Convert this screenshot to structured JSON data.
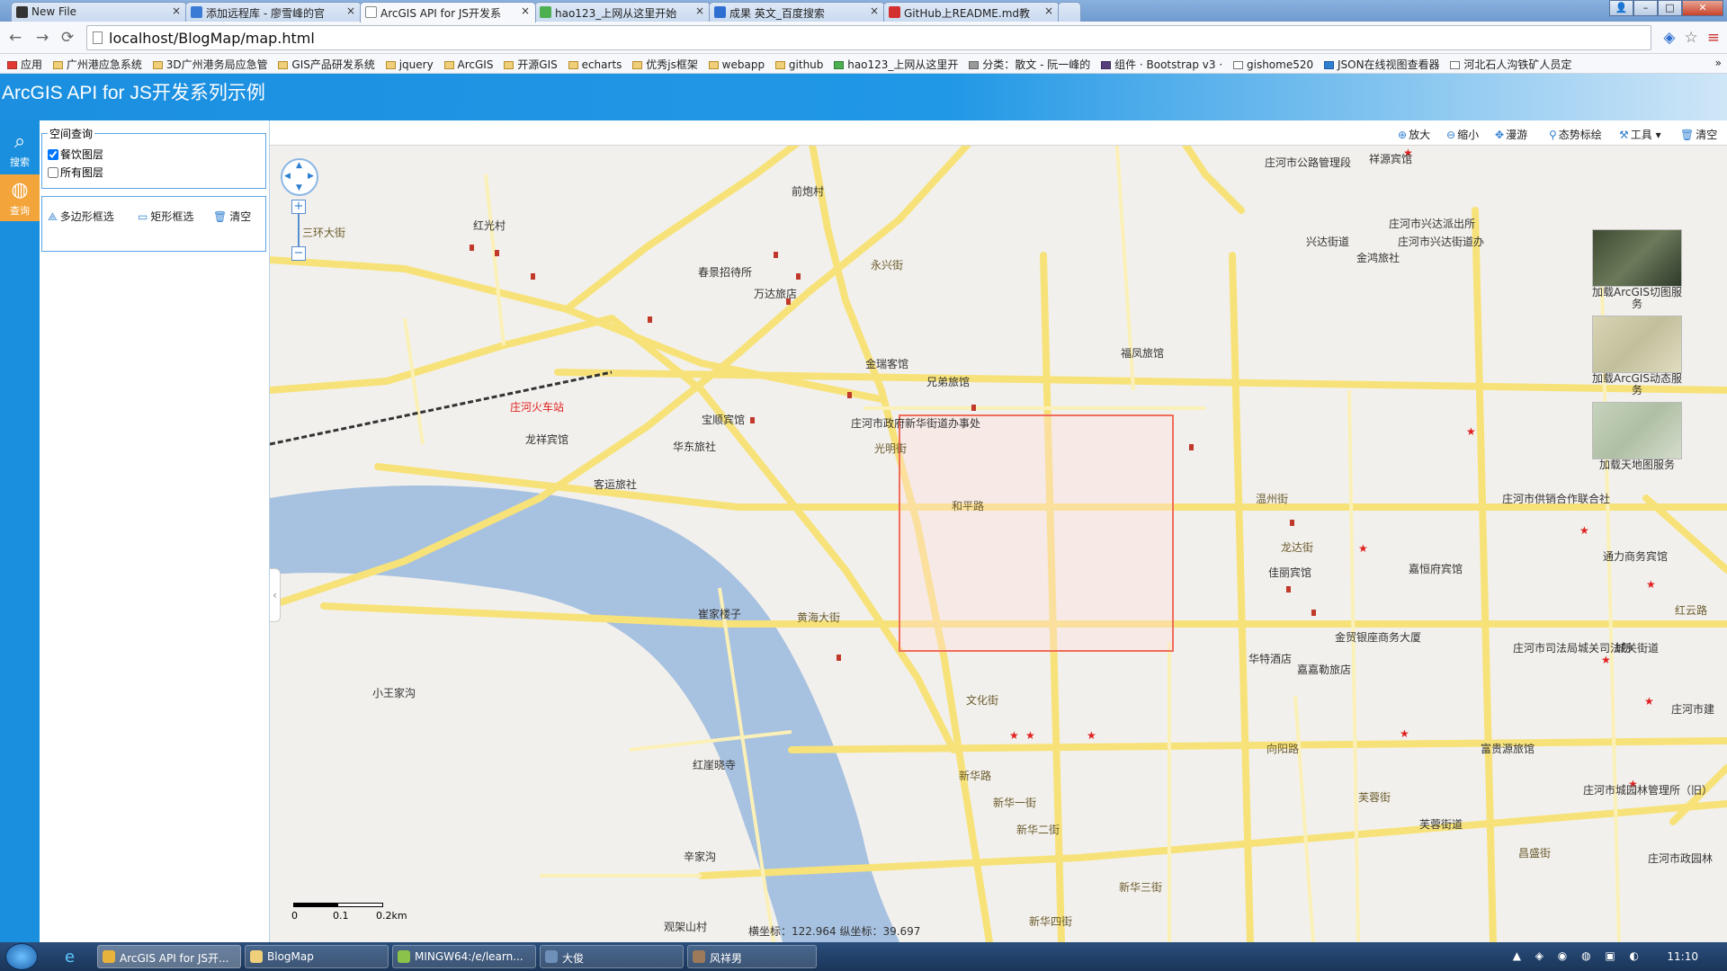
{
  "browser": {
    "tabs": [
      {
        "label": "New File",
        "icon_color": "#333333"
      },
      {
        "label": "添加远程库 - 廖雪峰的官",
        "icon_color": "#3a7bd5"
      },
      {
        "label": "ArcGIS API for JS开发系",
        "icon_color": "#777777",
        "active": true
      },
      {
        "label": "hao123_上网从这里开始",
        "icon_color": "#4caf50"
      },
      {
        "label": "成果 英文_百度搜索",
        "icon_color": "#2f6fd1"
      },
      {
        "label": "GitHub上README.md教",
        "icon_color": "#d32f2f"
      }
    ],
    "url": "localhost/BlogMap/map.html",
    "bookmarks": [
      "应用",
      "广州港应急系统",
      "3D广州港务局应急管",
      "GIS产品研发系统",
      "jquery",
      "ArcGIS",
      "开源GIS",
      "echarts",
      "优秀js框架",
      "webapp",
      "github",
      "hao123_上网从这里开",
      "分类：散文 - 阮一峰的",
      "组件 · Bootstrap v3 ·",
      "gishome520",
      "JSON在线视图查看器",
      "河北石人沟铁矿人员定"
    ]
  },
  "app": {
    "title": "ArcGIS API for JS开发系列示例",
    "nav": [
      {
        "label": "搜索",
        "icon": "search-icon"
      },
      {
        "label": "查询",
        "icon": "globe-icon"
      }
    ]
  },
  "panel": {
    "legend": "空间查询",
    "layers": [
      {
        "label": "餐饮图层",
        "checked": true
      },
      {
        "label": "所有图层",
        "checked": false
      }
    ],
    "tools": [
      {
        "label": "多边形框选",
        "icon": "polygon-select-icon"
      },
      {
        "label": "矩形框选",
        "icon": "rect-select-icon"
      },
      {
        "label": "清空",
        "icon": "trash-icon"
      }
    ]
  },
  "map_toolbar": [
    {
      "label": "放大",
      "icon": "zoom-in-icon"
    },
    {
      "label": "缩小",
      "icon": "zoom-out-icon"
    },
    {
      "label": "漫游",
      "icon": "pan-icon"
    },
    {
      "label": "态势标绘",
      "icon": "pin-icon"
    },
    {
      "label": "工具",
      "icon": "wrench-icon"
    },
    {
      "label": "清空",
      "icon": "trash-icon"
    }
  ],
  "basemaps": [
    {
      "label": "加载ArcGIS切图服务",
      "thumb_color": "#4c5a3e"
    },
    {
      "label": "加载ArcGIS动态服务",
      "thumb_color": "#c9c6a8"
    },
    {
      "label": "加载天地图服务",
      "thumb_color": "#b9c7b0"
    }
  ],
  "map_labels": [
    "庄河市公路管理段",
    "祥源宾馆",
    "前炮村",
    "红光村",
    "三环大街",
    "春景招待所",
    "万达旅店",
    "永兴街",
    "金瑞客馆",
    "兄弟旅馆",
    "庄河火车站",
    "龙祥宾馆",
    "宝顺宾馆",
    "华东旅社",
    "客运旅社",
    "庄河市政府新华街道办事处",
    "光明街",
    "和平路",
    "黄海大街",
    "崔家楼子",
    "小王家沟",
    "红崖晓寺",
    "辛家沟",
    "观架山村",
    "文化街",
    "新华路",
    "新华一街",
    "新华二街",
    "新华三街",
    "新华四街",
    "庄河市兴达派出所",
    "兴达街道",
    "庄河市兴达街道办",
    "金鸿旅社",
    "福凤旅馆",
    "温州街",
    "龙达街",
    "佳丽宾馆",
    "嘉恒府宾馆",
    "华特酒店",
    "嘉嘉勒旅店",
    "金贸银座商务大厦",
    "庄河市供销合作联合社",
    "通力商务宾馆",
    "庄河市司法局城关司法所",
    "城关街道",
    "昌盛街",
    "芙蓉街",
    "芙蓉街道",
    "庄河市城园林管理所（旧）",
    "庄河市政园林",
    "富贵源旅馆",
    "红云路",
    "向阳路",
    "庄河市建"
  ],
  "scale": {
    "ticks": [
      "0",
      "0.1",
      "0.2km"
    ]
  },
  "coordinates": "横坐标：122.964 纵坐标：39.697",
  "taskbar": {
    "apps": [
      {
        "label": "ArcGIS API for JS开...",
        "icon_color": "#e8b33a"
      },
      {
        "label": "BlogMap",
        "icon_color": "#f0cf7a"
      },
      {
        "label": "MINGW64:/e/learn...",
        "icon_color": "#8bc34a"
      },
      {
        "label": "大俊",
        "icon_color": "#6d8fb8"
      },
      {
        "label": "风祥男",
        "icon_color": "#9c7a5a"
      }
    ],
    "clock": "11:10"
  }
}
